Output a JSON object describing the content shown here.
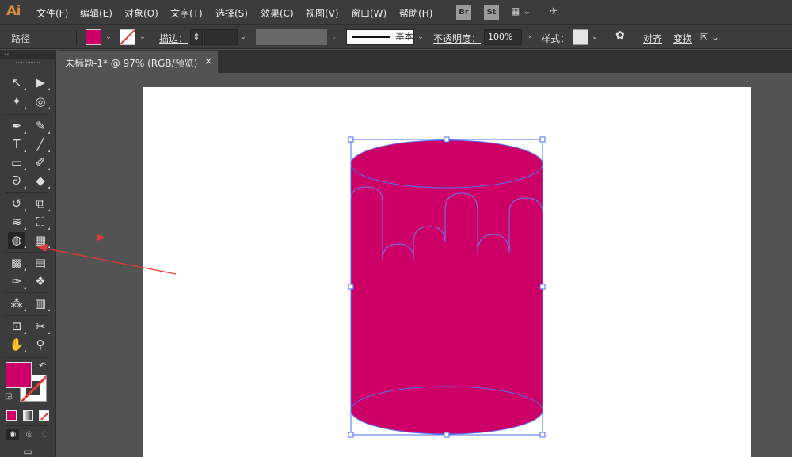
{
  "app": {
    "logo": "Ai"
  },
  "menu": [
    {
      "id": "file",
      "label": "文件(F)"
    },
    {
      "id": "edit",
      "label": "编辑(E)"
    },
    {
      "id": "object",
      "label": "对象(O)"
    },
    {
      "id": "type",
      "label": "文字(T)"
    },
    {
      "id": "select",
      "label": "选择(S)"
    },
    {
      "id": "effect",
      "label": "效果(C)"
    },
    {
      "id": "view",
      "label": "视图(V)"
    },
    {
      "id": "window",
      "label": "窗口(W)"
    },
    {
      "id": "help",
      "label": "帮助(H)"
    }
  ],
  "menu_buttons": {
    "bridge": "Br",
    "stock": "St"
  },
  "control": {
    "selection_label": "路径",
    "fill_color": "#cc0066",
    "stroke_label": "描边：",
    "stroke_profile": "基本",
    "opacity_label": "不透明度：",
    "opacity_value": "100%",
    "style_label": "样式：",
    "align_label": "对齐",
    "transform_label": "变换"
  },
  "document": {
    "tab_title": "未标题-1* @ 97% (RGB/预览)",
    "close": "×"
  },
  "tools": [
    {
      "id": "selection-tool",
      "glyph": "↖"
    },
    {
      "id": "direct-selection-tool",
      "glyph": "▶"
    },
    {
      "id": "magic-wand-tool",
      "glyph": "✦"
    },
    {
      "id": "lasso-tool",
      "glyph": "◎"
    },
    {
      "id": "pen-tool",
      "glyph": "✒"
    },
    {
      "id": "curvature-tool",
      "glyph": "✎"
    },
    {
      "id": "type-tool",
      "glyph": "T"
    },
    {
      "id": "line-tool",
      "glyph": "╱"
    },
    {
      "id": "rectangle-tool",
      "glyph": "▭"
    },
    {
      "id": "paintbrush-tool",
      "glyph": "✐"
    },
    {
      "id": "shaper-tool",
      "glyph": "ᘐ"
    },
    {
      "id": "eraser-tool",
      "glyph": "◆"
    },
    {
      "id": "rotate-tool",
      "glyph": "↺"
    },
    {
      "id": "scale-tool",
      "glyph": "⧉"
    },
    {
      "id": "warp-tool",
      "glyph": "≋"
    },
    {
      "id": "free-transform-tool",
      "glyph": "⛶"
    },
    {
      "id": "shape-builder-tool",
      "glyph": "◍"
    },
    {
      "id": "perspective-grid-tool",
      "glyph": "▦"
    },
    {
      "id": "mesh-tool",
      "glyph": "▩"
    },
    {
      "id": "gradient-tool",
      "glyph": "▤"
    },
    {
      "id": "eyedropper-tool",
      "glyph": "✑"
    },
    {
      "id": "blend-tool",
      "glyph": "❖"
    },
    {
      "id": "symbol-sprayer-tool",
      "glyph": "⁂"
    },
    {
      "id": "column-graph-tool",
      "glyph": "▥"
    },
    {
      "id": "artboard-tool",
      "glyph": "⊡"
    },
    {
      "id": "slice-tool",
      "glyph": "✂"
    },
    {
      "id": "hand-tool",
      "glyph": "✋"
    },
    {
      "id": "zoom-tool",
      "glyph": "⚲"
    }
  ],
  "colors": {
    "fill": "#cc0066",
    "stroke": "#ffffff",
    "selection": "#4a6cf5",
    "annotation": "#e53935",
    "accent": "#d98a3a"
  }
}
